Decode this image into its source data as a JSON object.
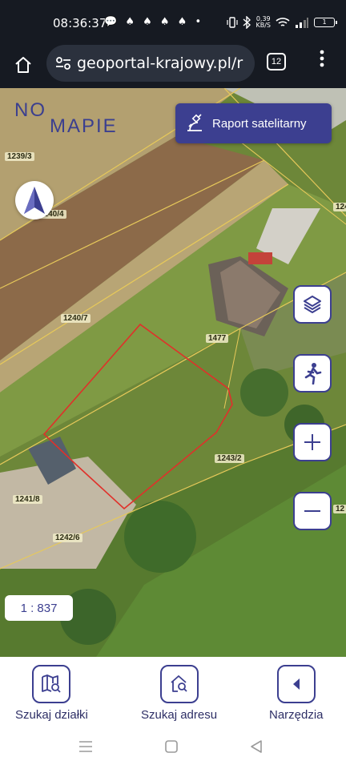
{
  "status_bar": {
    "time": "08:36:37",
    "notification_icons": "💬 ♠ ♠ ♠ ♠ •",
    "net_speed": "0,39",
    "net_speed_unit": "KB/S",
    "battery": "1"
  },
  "browser": {
    "url": "geoportal-krajowy.pl/r",
    "tab_count": "12"
  },
  "map": {
    "logo_line1": "NO",
    "logo_line2": "MAPIE",
    "raport_label": "Raport satelitarny",
    "scale": "1 : 837",
    "parcels": {
      "p1239_3": "1239/3",
      "p1240_4": "1240/4",
      "p1240_7": "1240/7",
      "p1477": "1477",
      "p1243_2": "1243/2",
      "p1241_8": "1241/8",
      "p1242_6": "1242/6",
      "p124_edge": "124",
      "p12_edge": "12"
    }
  },
  "bottom_nav": {
    "search_parcel": "Szukaj działki",
    "search_address": "Szukaj adresu",
    "tools": "Narzędzia"
  },
  "colors": {
    "accent": "#3c3f90",
    "parcel_outline": "#e0302a",
    "parcel_boundaries": "#e7c95a"
  }
}
